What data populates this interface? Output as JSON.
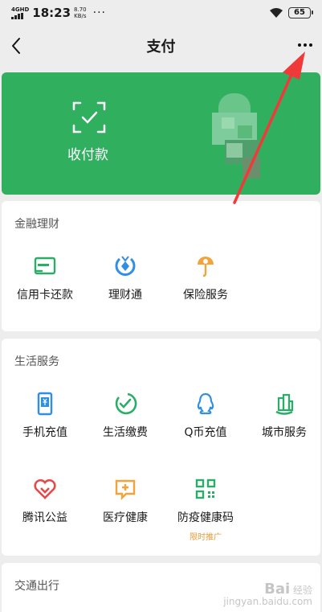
{
  "status_bar": {
    "network": "4GHD",
    "time": "18:23",
    "speed_value": "8.70",
    "speed_unit": "KB/s",
    "more": "···",
    "battery": "65"
  },
  "nav": {
    "title": "支付",
    "back_icon": "chevron-left-icon",
    "more_icon": "more-horizontal-icon"
  },
  "pay_card": {
    "label": "收付款",
    "icon": "scan-code-icon",
    "color": "#30b05f"
  },
  "finance": {
    "title": "金融理财",
    "items": [
      {
        "label": "信用卡还款",
        "icon": "credit-card-icon"
      },
      {
        "label": "理财通",
        "icon": "wealth-icon"
      },
      {
        "label": "保险服务",
        "icon": "insurance-icon"
      }
    ]
  },
  "life": {
    "title": "生活服务",
    "items": [
      {
        "label": "手机充值",
        "icon": "phone-topup-icon"
      },
      {
        "label": "生活缴费",
        "icon": "utility-payment-icon"
      },
      {
        "label": "Q币充值",
        "icon": "qq-coin-icon"
      },
      {
        "label": "城市服务",
        "icon": "city-service-icon"
      },
      {
        "label": "腾讯公益",
        "icon": "charity-heart-icon"
      },
      {
        "label": "医疗健康",
        "icon": "medical-icon"
      },
      {
        "label": "防疫健康码",
        "icon": "qr-health-code-icon",
        "tag": "限时推广"
      }
    ]
  },
  "transport": {
    "title": "交通出行"
  },
  "watermark": {
    "line1": "Bai",
    "line2": "经验",
    "line3": "jingyan.baidu.com"
  },
  "colors": {
    "accent": "#30b05f",
    "arrow": "#f03a3a",
    "tag": "#e49b3c"
  }
}
